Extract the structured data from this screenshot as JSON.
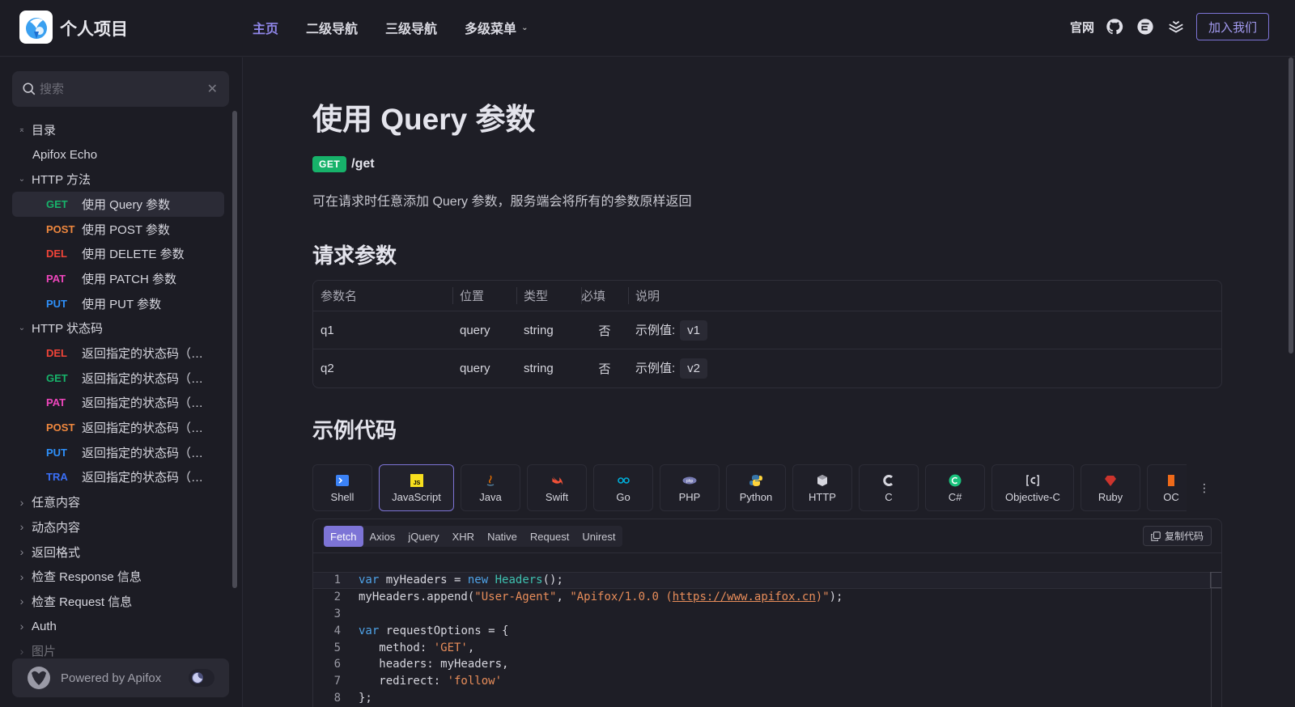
{
  "header": {
    "site_title": "个人项目",
    "nav": [
      {
        "label": "主页",
        "active": true
      },
      {
        "label": "二级导航",
        "active": false
      },
      {
        "label": "三级导航",
        "active": false
      },
      {
        "label": "多级菜单",
        "active": false,
        "dropdown": true
      }
    ],
    "official_link": "官网",
    "icons": [
      "github-icon",
      "gitee-icon",
      "layers-icon"
    ],
    "join_button": "加入我们"
  },
  "sidebar": {
    "search_placeholder": "搜索",
    "toc_label": "目录",
    "items": [
      {
        "type": "leaf",
        "label": "Apifox Echo"
      },
      {
        "type": "folder",
        "label": "HTTP 方法",
        "expanded": true
      },
      {
        "type": "api",
        "method": "GET",
        "label": "使用 Query 参数",
        "active": true
      },
      {
        "type": "api",
        "method": "POST",
        "label": "使用 POST 参数"
      },
      {
        "type": "api",
        "method": "DEL",
        "label": "使用 DELETE 参数"
      },
      {
        "type": "api",
        "method": "PAT",
        "label": "使用 PATCH 参数"
      },
      {
        "type": "api",
        "method": "PUT",
        "label": "使用 PUT 参数"
      },
      {
        "type": "folder",
        "label": "HTTP 状态码",
        "expanded": true
      },
      {
        "type": "api",
        "method": "DEL",
        "label": "返回指定的状态码（可..."
      },
      {
        "type": "api",
        "method": "GET",
        "label": "返回指定的状态码（可..."
      },
      {
        "type": "api",
        "method": "PAT",
        "label": "返回指定的状态码（可..."
      },
      {
        "type": "api",
        "method": "POST",
        "label": "返回指定的状态码（可..."
      },
      {
        "type": "api",
        "method": "PUT",
        "label": "返回指定的状态码（可..."
      },
      {
        "type": "api",
        "method": "TRA",
        "label": "返回指定的状态码（可..."
      },
      {
        "type": "folder",
        "label": "任意内容",
        "expanded": false
      },
      {
        "type": "folder",
        "label": "动态内容",
        "expanded": false
      },
      {
        "type": "folder",
        "label": "返回格式",
        "expanded": false
      },
      {
        "type": "folder",
        "label": "检查 Response 信息",
        "expanded": false
      },
      {
        "type": "folder",
        "label": "检查 Request 信息",
        "expanded": false
      },
      {
        "type": "folder",
        "label": "Auth",
        "expanded": false
      },
      {
        "type": "folder",
        "label": "图片",
        "expanded": false
      }
    ],
    "powered_by": "Powered by Apifox"
  },
  "method_colors": {
    "GET": "#17b26a",
    "POST": "#f0883e",
    "DEL": "#f04438",
    "PAT": "#ee46bc",
    "PUT": "#2e90fa",
    "TRA": "#3a6ff7"
  },
  "main": {
    "title": "使用 Query 参数",
    "method": "GET",
    "path": "/get",
    "description": "可在请求时任意添加 Query 参数，服务端会将所有的参数原样返回",
    "params_heading": "请求参数",
    "params_columns": [
      "参数名",
      "位置",
      "类型",
      "必填",
      "说明"
    ],
    "params": [
      {
        "name": "q1",
        "in": "query",
        "type": "string",
        "required": "否",
        "example_label": "示例值:",
        "example": "v1"
      },
      {
        "name": "q2",
        "in": "query",
        "type": "string",
        "required": "否",
        "example_label": "示例值:",
        "example": "v2"
      }
    ],
    "code_heading": "示例代码",
    "languages": [
      "Shell",
      "JavaScript",
      "Java",
      "Swift",
      "Go",
      "PHP",
      "Python",
      "HTTP",
      "C",
      "C#",
      "Objective-C",
      "Ruby",
      "OC"
    ],
    "active_language": "JavaScript",
    "libraries": [
      "Fetch",
      "Axios",
      "jQuery",
      "XHR",
      "Native",
      "Request",
      "Unirest"
    ],
    "active_library": "Fetch",
    "copy_button": "复制代码",
    "code_lines": [
      "var myHeaders = new Headers();",
      "myHeaders.append(\"User-Agent\", \"Apifox/1.0.0 (https://www.apifox.cn)\");",
      "",
      "var requestOptions = {",
      "   method: 'GET',",
      "   headers: myHeaders,",
      "   redirect: 'follow'",
      "};"
    ]
  }
}
